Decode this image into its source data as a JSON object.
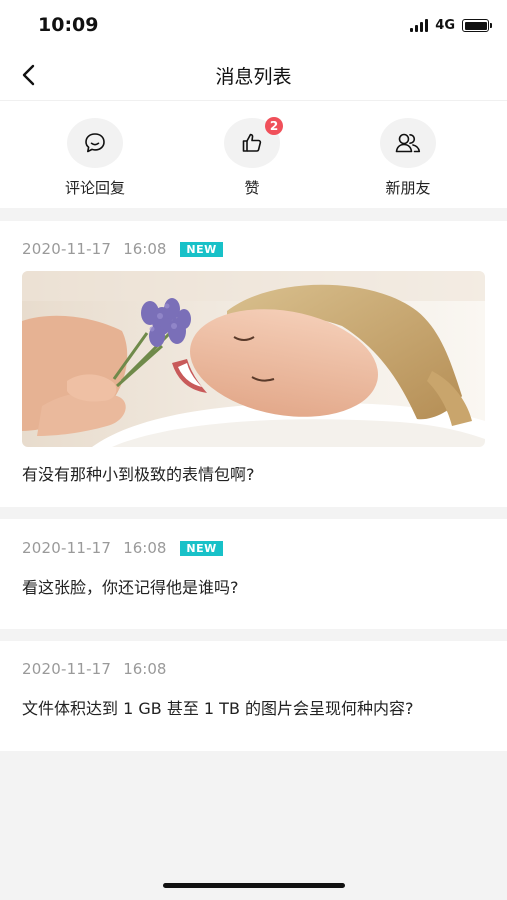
{
  "status_bar": {
    "time": "10:09",
    "network": "4G"
  },
  "nav": {
    "title": "消息列表"
  },
  "shortcuts": [
    {
      "label": "评论回复",
      "icon": "comment-icon"
    },
    {
      "label": "赞",
      "icon": "thumbs-up-icon",
      "badge": "2"
    },
    {
      "label": "新朋友",
      "icon": "new-friends-icon"
    }
  ],
  "messages": [
    {
      "date": "2020-11-17",
      "time": "16:08",
      "tag": "NEW",
      "has_image": true,
      "text": "有没有那种小到极致的表情包啊?"
    },
    {
      "date": "2020-11-17",
      "time": "16:08",
      "tag": "NEW",
      "has_image": false,
      "text": "看这张脸，你还记得他是谁吗?"
    },
    {
      "date": "2020-11-17",
      "time": "16:08",
      "tag": "",
      "has_image": false,
      "text": "文件体积达到 1 GB 甚至 1 TB 的图片会呈现何种内容?"
    }
  ],
  "colors": {
    "accent": "#18c1c8",
    "badge": "#f0505a",
    "background": "#f3f3f3"
  }
}
